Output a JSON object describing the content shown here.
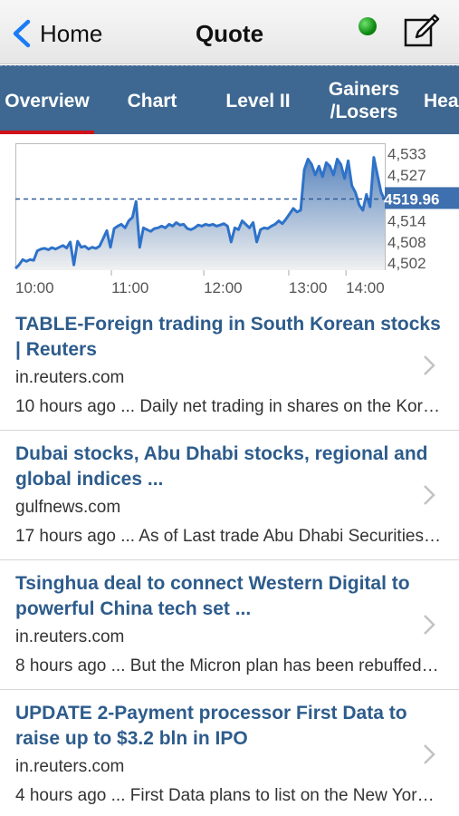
{
  "nav": {
    "back_label": "Home",
    "title": "Quote"
  },
  "tabs": [
    {
      "label": "Overview"
    },
    {
      "label": "Chart"
    },
    {
      "label": "Level II"
    },
    {
      "label": "Gainers\n/Losers"
    },
    {
      "label": "Hea"
    }
  ],
  "colors": {
    "tab_bg": "#3e6891",
    "active_tab_underline": "#d0121b",
    "headline": "#2d5c8c",
    "status": "#1a9c1e"
  },
  "chart_data": {
    "type": "area",
    "x_tick_labels": [
      "10:00",
      "11:00",
      "12:00",
      "13:00",
      "14:00"
    ],
    "y_tick_labels": [
      "4,533",
      "4,527",
      "4,514",
      "4,508",
      "4,502"
    ],
    "ylim": [
      4500,
      4536
    ],
    "current_value_label": "4519.96",
    "reference_line": 4520.2,
    "series": [
      {
        "values": [
          4500.5,
          4501.5,
          4503.0,
          4502.5,
          4503.0,
          4502.8,
          4505.5,
          4506.0,
          4506.2,
          4505.8,
          4506.4,
          4506.0,
          4506.5,
          4507.0,
          4506.3,
          4508.0,
          4501.5,
          4508.2,
          4506.5,
          4506.8,
          4506.0,
          4506.5,
          4506.2,
          4506.8,
          4509.0,
          4511.2,
          4506.5,
          4511.8,
          4512.5,
          4513.0,
          4512.0,
          4514.0,
          4515.0,
          4519.5,
          4506.5,
          4512.0,
          4511.5,
          4511.0,
          4511.8,
          4512.0,
          4512.5,
          4512.0,
          4513.0,
          4512.5,
          4513.5,
          4512.8,
          4513.0,
          4511.8,
          4511.5,
          4512.0,
          4512.8,
          4512.5,
          4513.0,
          4512.7,
          4513.0,
          4512.5,
          4512.8,
          4513.2,
          4512.5,
          4508.0,
          4512.0,
          4511.5,
          4514.0,
          4513.0,
          4512.0,
          4513.5,
          4508.0,
          4511.5,
          4512.0,
          4511.8,
          4512.5,
          4513.0,
          4514.0,
          4513.2,
          4514.5,
          4516.0,
          4517.5,
          4516.5,
          4517.0,
          4528.5,
          4531.5,
          4530.0,
          4527.0,
          4529.5,
          4526.5,
          4530.5,
          4529.5,
          4527.0,
          4531.5,
          4530.0,
          4526.0,
          4531.0,
          4524.0,
          4522.0,
          4518.5,
          4517.0,
          4521.5,
          4518.0,
          4532.0,
          4527.0,
          4522.0,
          4519.96
        ]
      }
    ]
  },
  "news": [
    {
      "title": "TABLE-Foreign trading in South Korean stocks | Reuters",
      "source": "in.reuters.com",
      "snippet": "10 hours ago ... Daily net trading in shares on the Korea Exchange's main board by foreign investors"
    },
    {
      "title": "Dubai stocks, Abu Dhabi stocks, regional and global indices ...",
      "source": "gulfnews.com",
      "snippet": "17 hours ago ... As of Last trade Abu Dhabi Securities Market General Index"
    },
    {
      "title": "Tsinghua deal to connect Western Digital to powerful China tech set ...",
      "source": "in.reuters.com",
      "snippet": "8 hours ago ... But the Micron plan has been rebuffed by the company"
    },
    {
      "title": "UPDATE 2-Payment processor First Data to raise up to $3.2 bln in IPO",
      "source": "in.reuters.com",
      "snippet": "4 hours ago ... First Data plans to list on the New York Stock Exchange"
    }
  ]
}
